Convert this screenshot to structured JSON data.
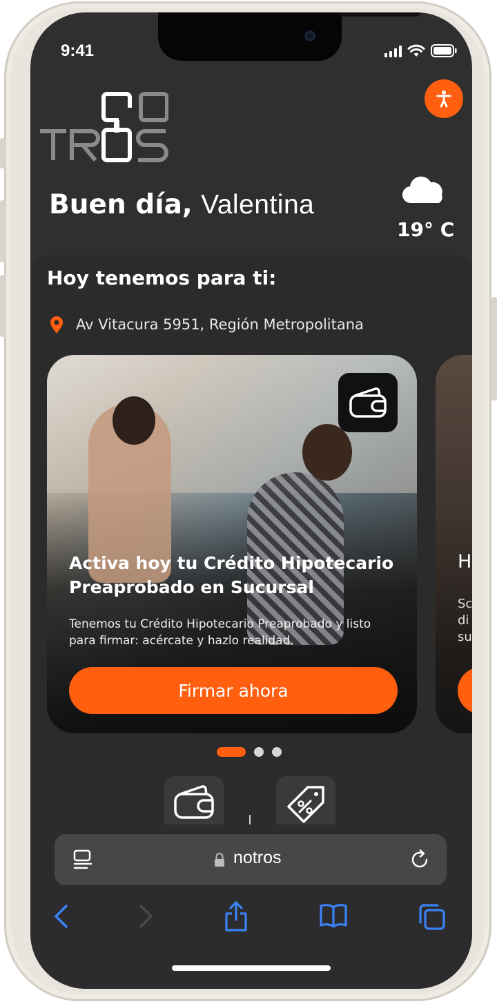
{
  "status_bar": {
    "time": "9:41"
  },
  "header": {
    "logo_text_top": "O",
    "logo_text_bottom": "TR",
    "logo_text_bottom_2": "S",
    "greeting_prefix": "Buen día,",
    "user_name": "Valentina",
    "weather_icon": "cloud-icon",
    "temperature": "19° C"
  },
  "accessibility": {
    "icon": "accessibility-icon",
    "color": "#FF5F0F"
  },
  "offers": {
    "section_title": "Hoy tenemos para ti:",
    "location": "Av Vitacura 5951, Región Metropolitana",
    "cards": [
      {
        "badge_icon": "wallet-icon",
        "title": "Activa hoy tu Crédito Hipotecario Preaprobado en Sucursal",
        "description": "Tenemos tu Crédito Hipotecario Preaprobado y listo para firmar: acércate y hazlo realidad.",
        "button_label": "Firmar ahora"
      },
      {
        "title_peek": "H",
        "desc_peek": [
          "Sc",
          "di",
          "su"
        ]
      }
    ],
    "pagination": {
      "current": 1,
      "total": 3
    }
  },
  "quick_actions": [
    {
      "icon": "wallet-icon"
    },
    {
      "icon": "discount-tag-icon"
    }
  ],
  "browser": {
    "url": "notros",
    "tabs_icon": "reader-icon",
    "reload_icon": "reload-icon",
    "toolbar": [
      "back-icon",
      "forward-icon",
      "share-icon",
      "bookmarks-icon",
      "tabs-icon"
    ]
  },
  "colors": {
    "accent": "#FF5F0F",
    "background": "#2F2F2F",
    "browser_link": "#3B82F6"
  }
}
